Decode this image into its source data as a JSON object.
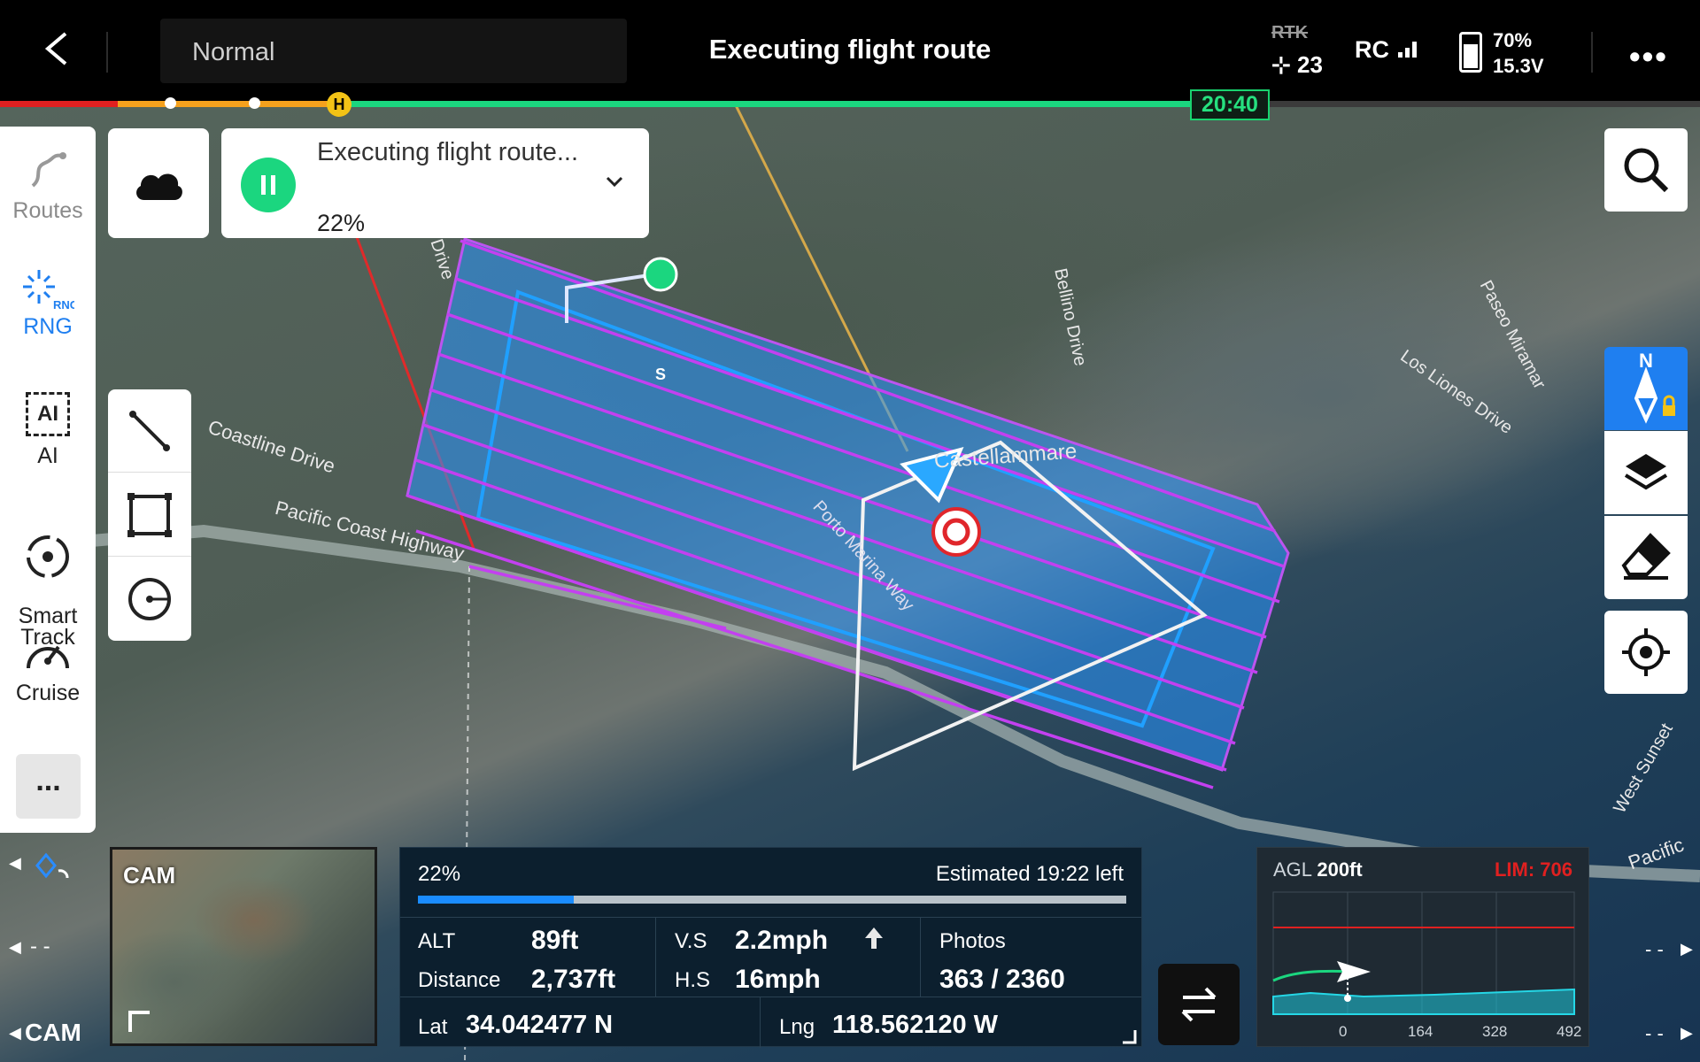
{
  "topbar": {
    "mode": "Normal",
    "title": "Executing flight route",
    "rtk": "RTK",
    "satellites": "23",
    "rc": "RC",
    "battery_percent": "70%",
    "battery_voltage": "15.3V",
    "timer": "20:40",
    "home_marker": "H"
  },
  "sidebar": {
    "items": [
      {
        "label": "Routes"
      },
      {
        "label": "RNG",
        "badge": "RNG"
      },
      {
        "label": "AI",
        "icon_text": "AI"
      },
      {
        "label": "Smart\nTrack"
      },
      {
        "label": "Cruise"
      }
    ],
    "more": "..."
  },
  "flight_card": {
    "title": "Executing flight route...",
    "progress": "22%"
  },
  "map": {
    "labels": [
      "Coastline Drive",
      "Pacific Coast Highway",
      "Bellino Drive",
      "Paseo Miramar",
      "Los Liones Drive",
      "Castellammare",
      "Porto Marina Way",
      "West Sunset",
      "Pacific",
      "ew Drive"
    ],
    "start_marker": "S",
    "compass_north": "N"
  },
  "telemetry": {
    "progress_text": "22%",
    "progress_fraction": 0.22,
    "estimate": "Estimated 19:22 left",
    "alt_label": "ALT",
    "alt_value": "89ft",
    "distance_label": "Distance",
    "distance_value": "2,737ft",
    "vs_label": "V.S",
    "vs_value": "2.2mph",
    "hs_label": "H.S",
    "hs_value": "16mph",
    "photos_label": "Photos",
    "photos_value": "363 / 2360",
    "lat_label": "Lat",
    "lat_value": "34.042477 N",
    "lng_label": "Lng",
    "lng_value": "118.562120 W"
  },
  "camera": {
    "label": "CAM"
  },
  "left_edge": {
    "cam": "CAM",
    "dash": "- -"
  },
  "altitude_chart": {
    "agl_label": "AGL",
    "agl_value": "200ft",
    "limit": "LIM: 706",
    "ticks": [
      "0",
      "164",
      "328",
      "492"
    ]
  },
  "colors": {
    "accent": "#1f7ff0",
    "go": "#1bd67f",
    "route": "#c040f0",
    "limit": "#e02020"
  }
}
